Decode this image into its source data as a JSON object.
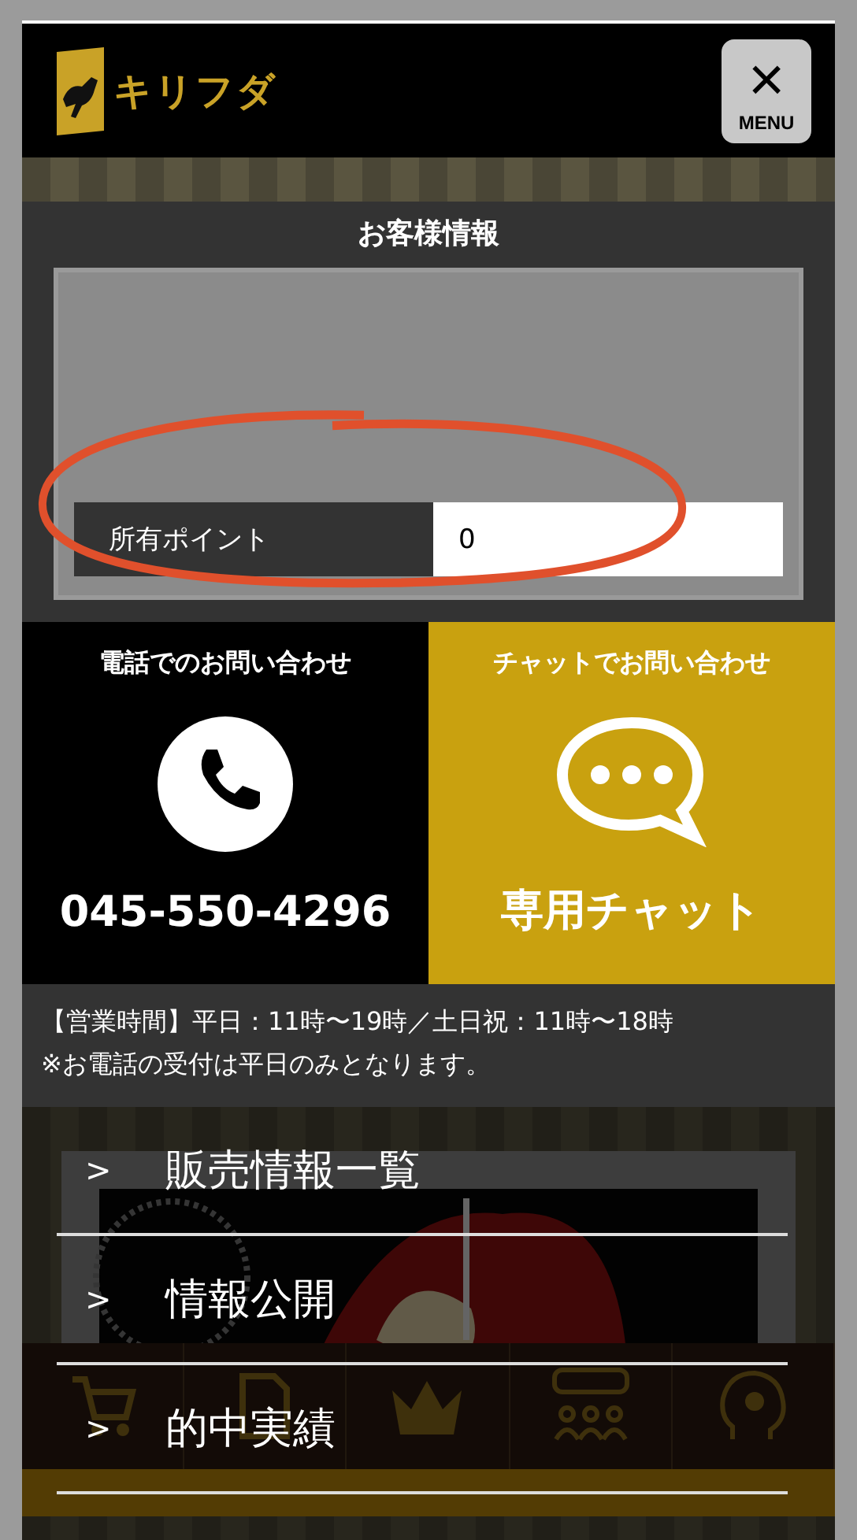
{
  "header": {
    "logo_text": "キリフダ",
    "menu_button": {
      "icon": "×",
      "label": "MENU"
    }
  },
  "customer_info": {
    "title": "お客様情報",
    "fields": [
      {
        "label": "所有ポイント",
        "value": "0",
        "circled": true
      }
    ]
  },
  "contact": [
    {
      "kind": "phone",
      "heading": "電話でのお問い合わせ",
      "action": "045-550-4296"
    },
    {
      "kind": "chat",
      "heading": "チャットでお問い合わせ",
      "action": "専用チャット"
    }
  ],
  "hours": [
    "【営業時間】平日：11時〜19時／土日祝：11時〜18時",
    "※お電話の受付は平日のみとなります。"
  ],
  "tab_bar": [
    {
      "kind": "cart"
    },
    {
      "kind": "document"
    },
    {
      "kind": "crown"
    },
    {
      "kind": "people"
    },
    {
      "kind": "support"
    }
  ],
  "menu": [
    {
      "marker": ">",
      "label": "販売情報一覧"
    },
    {
      "marker": ">",
      "label": "情報公開"
    },
    {
      "marker": ">",
      "label": "的中実績"
    }
  ]
}
